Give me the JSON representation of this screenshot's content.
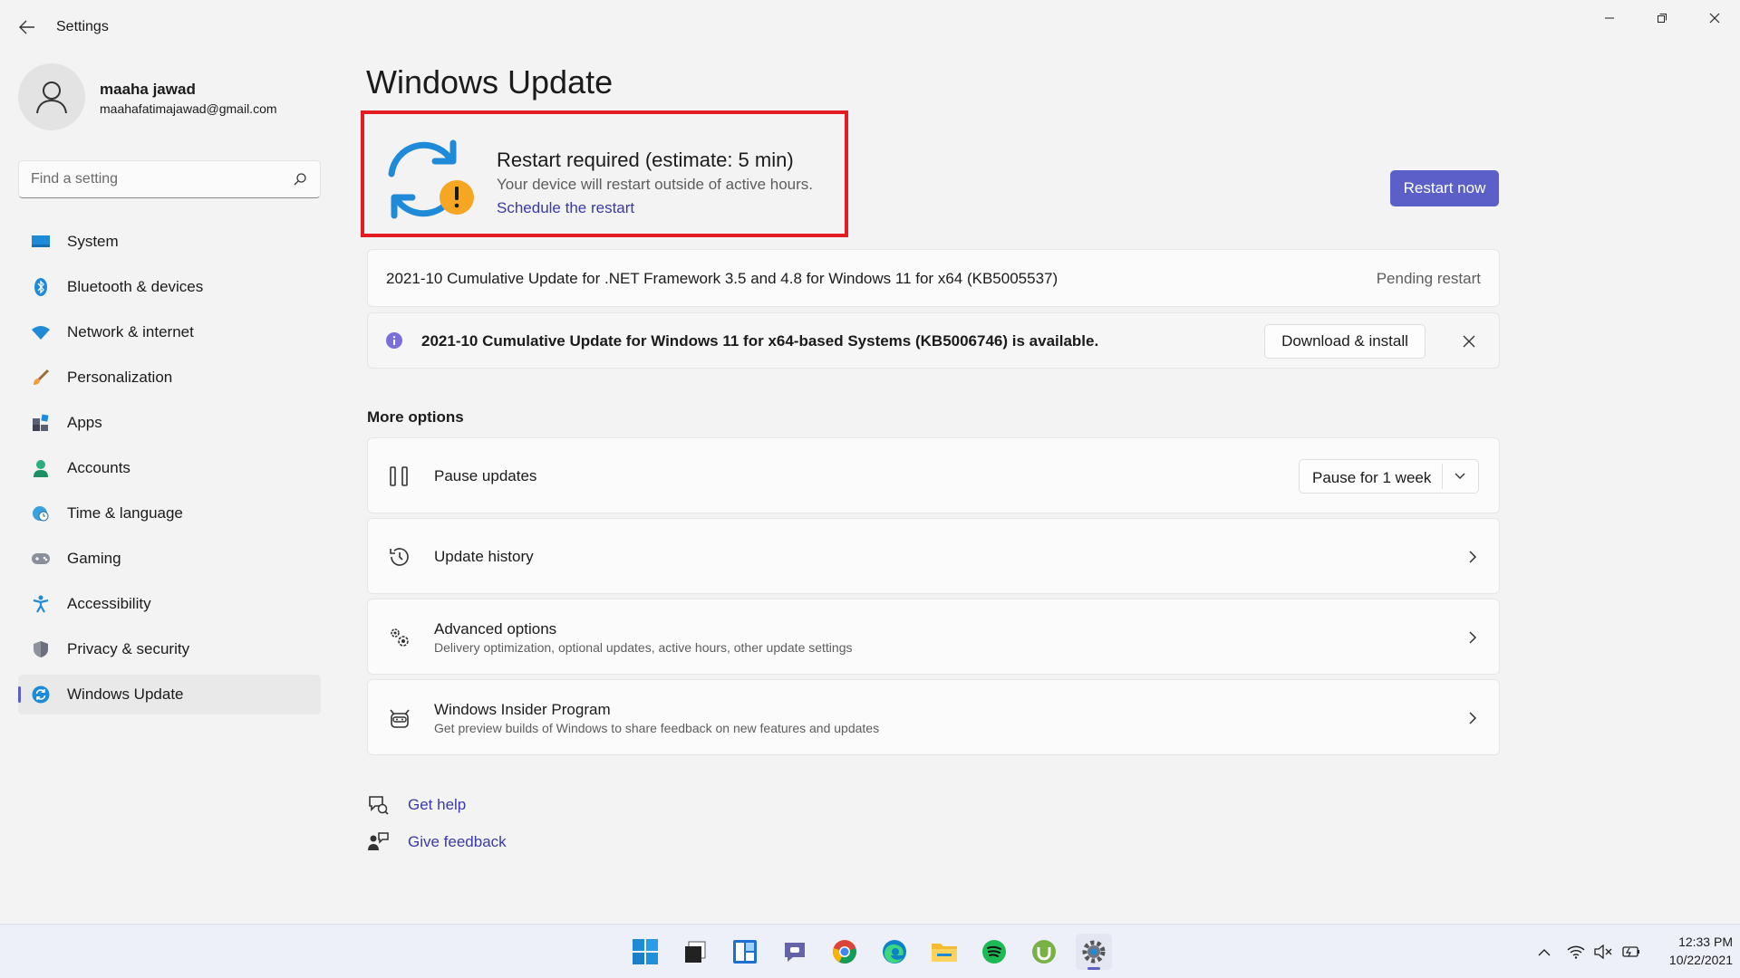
{
  "window": {
    "title": "Settings",
    "controls": [
      "minimize",
      "restore",
      "close"
    ]
  },
  "profile": {
    "name": "maaha jawad",
    "email": "maahafatimajawad@gmail.com"
  },
  "search": {
    "placeholder": "Find a setting"
  },
  "sidebar": {
    "items": [
      {
        "label": "System",
        "icon": "system-icon"
      },
      {
        "label": "Bluetooth & devices",
        "icon": "bluetooth-icon"
      },
      {
        "label": "Network & internet",
        "icon": "wifi-icon"
      },
      {
        "label": "Personalization",
        "icon": "brush-icon"
      },
      {
        "label": "Apps",
        "icon": "apps-icon"
      },
      {
        "label": "Accounts",
        "icon": "accounts-icon"
      },
      {
        "label": "Time & language",
        "icon": "globe-clock-icon"
      },
      {
        "label": "Gaming",
        "icon": "gamepad-icon"
      },
      {
        "label": "Accessibility",
        "icon": "accessibility-icon"
      },
      {
        "label": "Privacy & security",
        "icon": "shield-icon"
      },
      {
        "label": "Windows Update",
        "icon": "update-icon",
        "active": true
      }
    ]
  },
  "main": {
    "title": "Windows Update",
    "status": {
      "title": "Restart required (estimate: 5 min)",
      "subtitle": "Your device will restart outside of active hours.",
      "link": "Schedule the restart"
    },
    "restart_button": "Restart now",
    "updates": [
      {
        "title": "2021-10 Cumulative Update for .NET Framework 3.5 and 4.8 for Windows 11 for x64 (KB5005537)",
        "status": "Pending restart"
      },
      {
        "title": "2021-10 Cumulative Update for Windows 11 for x64-based Systems (KB5006746) is available.",
        "action": "Download & install"
      }
    ],
    "more_options_label": "More options",
    "options": [
      {
        "title": "Pause updates",
        "select_value": "Pause for 1 week",
        "icon": "pause-icon"
      },
      {
        "title": "Update history",
        "icon": "history-icon"
      },
      {
        "title": "Advanced options",
        "description": "Delivery optimization, optional updates, active hours, other update settings",
        "icon": "gears-icon"
      },
      {
        "title": "Windows Insider Program",
        "description": "Get preview builds of Windows to share feedback on new features and updates",
        "icon": "ninja-cat-icon"
      }
    ],
    "help_links": [
      {
        "label": "Get help",
        "icon": "help-icon"
      },
      {
        "label": "Give feedback",
        "icon": "feedback-icon"
      }
    ]
  },
  "taskbar": {
    "apps": [
      "start",
      "task-view",
      "widgets",
      "teams-chat",
      "chrome",
      "edge",
      "file-explorer",
      "spotify",
      "utorrent",
      "settings"
    ],
    "clock": {
      "time": "12:33 PM",
      "date": "10/22/2021"
    }
  },
  "colors": {
    "accent": "#5b5fc7",
    "highlight_border": "#e31b23",
    "link": "#3a3aa8",
    "update_blue": "#1f8ad8",
    "warning": "#f5a623"
  }
}
